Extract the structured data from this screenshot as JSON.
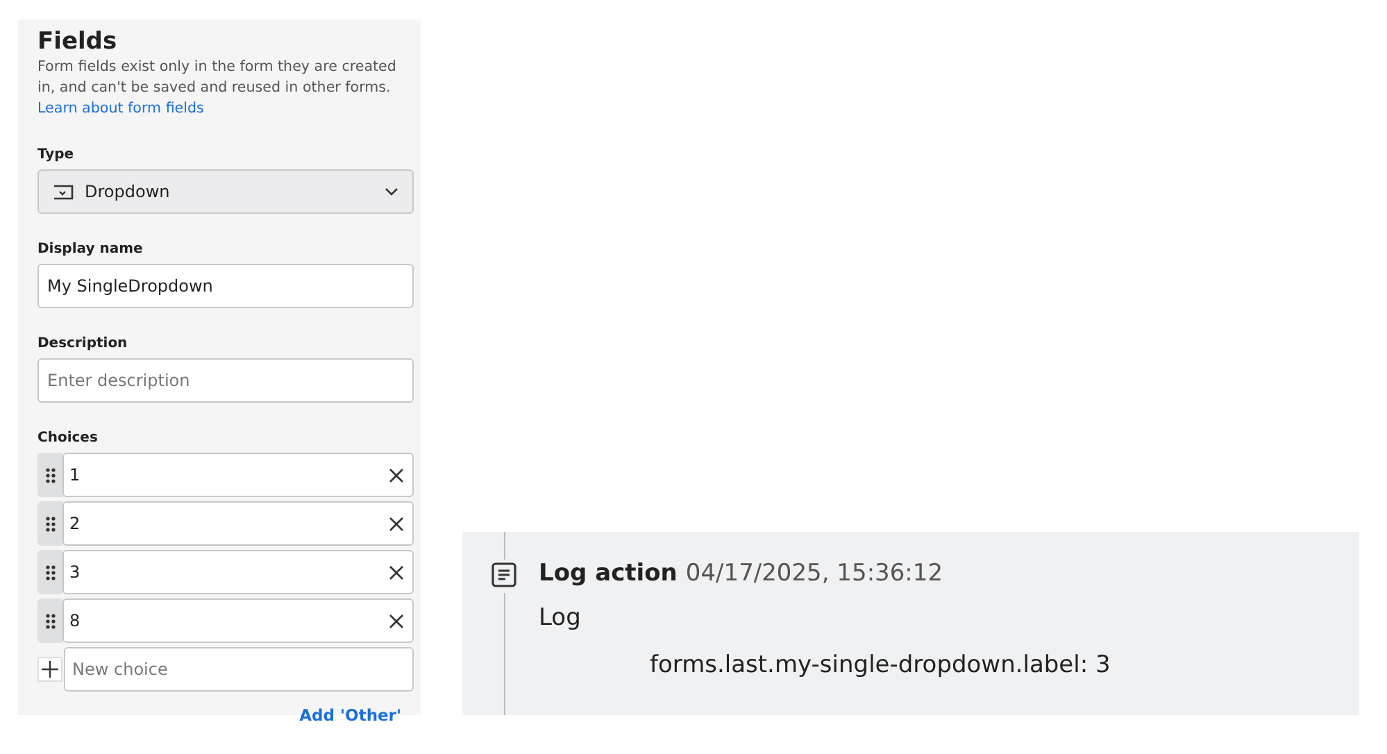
{
  "fields_panel": {
    "title": "Fields",
    "description": "Form fields exist only in the form they are created in, and can't be saved and reused in other forms.",
    "learn_link": "Learn about form fields",
    "type": {
      "label": "Type",
      "value": "Dropdown"
    },
    "display_name": {
      "label": "Display name",
      "value": "My SingleDropdown"
    },
    "description_field": {
      "label": "Description",
      "placeholder": "Enter description"
    },
    "choices": {
      "label": "Choices",
      "items": [
        {
          "value": "1"
        },
        {
          "value": "2"
        },
        {
          "value": "3"
        },
        {
          "value": "8"
        }
      ],
      "new_choice": {
        "placeholder": "New choice"
      },
      "add_other": "Add 'Other'"
    }
  },
  "log_entry": {
    "title": "Log action",
    "timestamp": "04/17/2025, 15:36:12",
    "message": "Log",
    "detail": "forms.last.my-single-dropdown.label: 3"
  }
}
